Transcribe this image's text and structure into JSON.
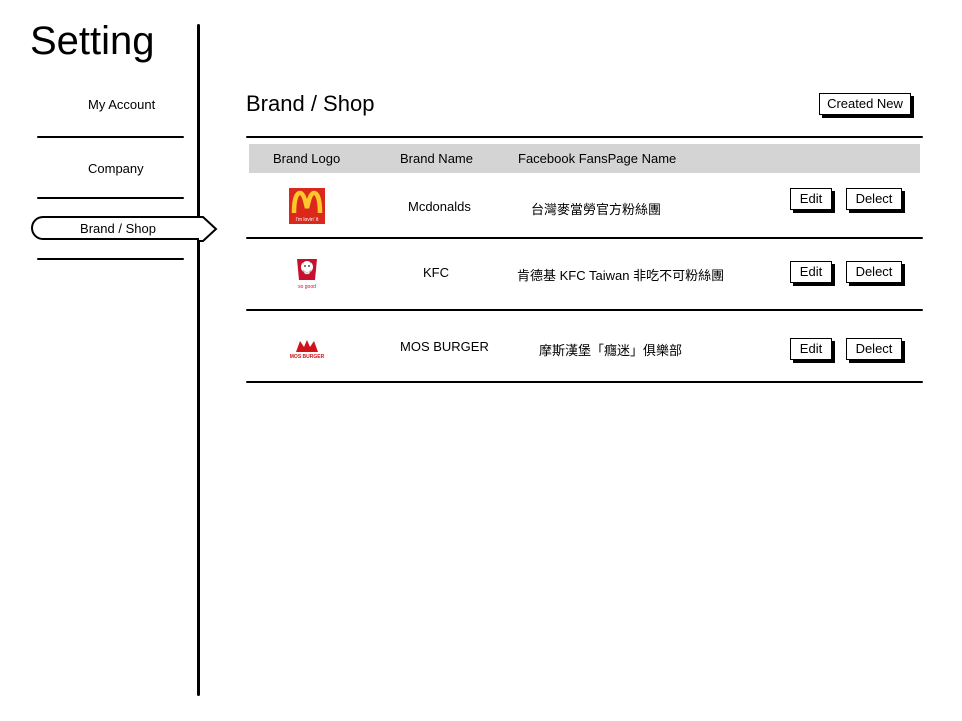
{
  "app": {
    "title": "Setting"
  },
  "sidebar": {
    "items": [
      {
        "label": "My Account"
      },
      {
        "label": "Company"
      },
      {
        "label": "Brand / Shop",
        "active": true
      }
    ]
  },
  "main": {
    "title": "Brand / Shop",
    "create_label": "Created New",
    "columns": [
      "Brand Logo",
      "Brand Name",
      "Facebook FansPage Name"
    ],
    "rows": [
      {
        "logo": "mcdonalds-logo",
        "logo_text": "I'm lovin' it",
        "name": "Mcdonalds",
        "fanspage": "台灣麥當勞官方粉絲團",
        "edit_label": "Edit",
        "delete_label": "Delect"
      },
      {
        "logo": "kfc-logo",
        "logo_text": "so good",
        "name": "KFC",
        "fanspage": "肯德基 KFC Taiwan 非吃不可粉絲團",
        "edit_label": "Edit",
        "delete_label": "Delect"
      },
      {
        "logo": "mos-burger-logo",
        "logo_text": "MOS BURGER",
        "name": "MOS BURGER",
        "fanspage": "摩斯漢堡「癮迷」俱樂部",
        "edit_label": "Edit",
        "delete_label": "Delect"
      }
    ]
  },
  "colors": {
    "header_bg": "#d4d4d4",
    "mcd_red": "#da291c",
    "mcd_yellow": "#ffc72c",
    "kfc_red": "#c8102e",
    "mos_red": "#d0121b"
  }
}
